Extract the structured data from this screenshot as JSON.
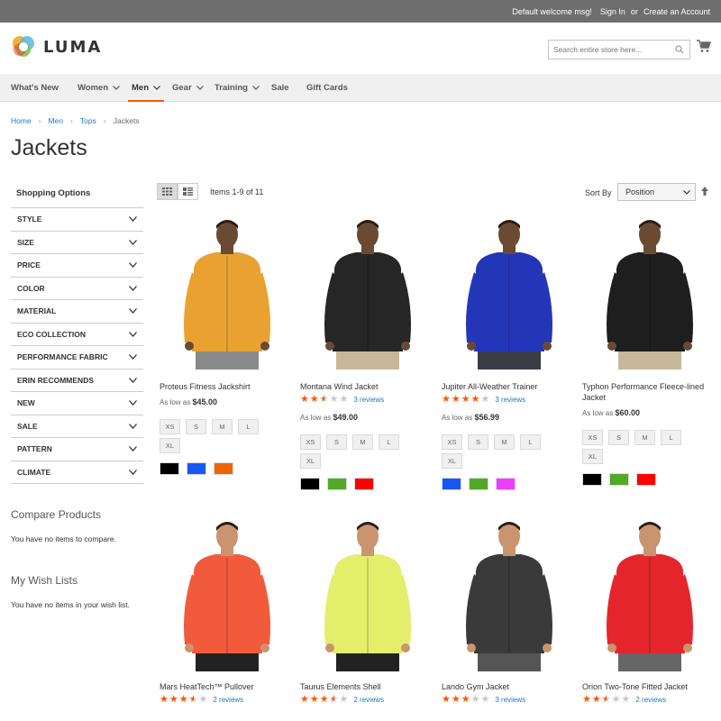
{
  "topbar": {
    "welcome": "Default welcome msg!",
    "sign_in": "Sign In",
    "or": "or",
    "create_account": "Create an Account"
  },
  "header": {
    "logo_text": "LUMA",
    "search_placeholder": "Search entire store here...",
    "icons": [
      "search-icon",
      "cart-icon"
    ]
  },
  "nav": {
    "items": [
      {
        "label": "What's New",
        "has_dropdown": false,
        "active": false
      },
      {
        "label": "Women",
        "has_dropdown": true,
        "active": false
      },
      {
        "label": "Men",
        "has_dropdown": true,
        "active": true
      },
      {
        "label": "Gear",
        "has_dropdown": true,
        "active": false
      },
      {
        "label": "Training",
        "has_dropdown": true,
        "active": false
      },
      {
        "label": "Sale",
        "has_dropdown": false,
        "active": false
      },
      {
        "label": "Gift Cards",
        "has_dropdown": false,
        "active": false
      }
    ]
  },
  "breadcrumb": {
    "items": [
      "Home",
      "Men",
      "Tops"
    ],
    "current": "Jackets"
  },
  "page_title": "Jackets",
  "sidebar": {
    "shopping_options": "Shopping Options",
    "filters": [
      "STYLE",
      "SIZE",
      "PRICE",
      "COLOR",
      "MATERIAL",
      "ECO COLLECTION",
      "PERFORMANCE FABRIC",
      "ERIN RECOMMENDS",
      "NEW",
      "SALE",
      "PATTERN",
      "CLIMATE"
    ],
    "compare_title": "Compare Products",
    "compare_text": "You have no items to compare.",
    "wishlist_title": "My Wish Lists",
    "wishlist_text": "You have no items in your wish list."
  },
  "toolbar": {
    "items_count": "Items 1-9 of 11",
    "sort_label": "Sort By",
    "sort_value": "Position"
  },
  "products": [
    {
      "name": "Proteus Fitness Jackshirt",
      "rating": 0,
      "reviews": "",
      "price_prefix": "As low as",
      "price": "$45.00",
      "sizes": [
        "XS",
        "S",
        "M",
        "L",
        "XL"
      ],
      "swatches": [
        "#000000",
        "#1857f7",
        "#eb6703"
      ],
      "jacket_color": "#e9a232",
      "pants_color": "#8a8a8a",
      "skin": "#6b4a34"
    },
    {
      "name": "Montana Wind Jacket",
      "rating": 2.5,
      "reviews": "3 reviews",
      "price_prefix": "As low as",
      "price": "$49.00",
      "sizes": [
        "XS",
        "S",
        "M",
        "L",
        "XL"
      ],
      "swatches": [
        "#000000",
        "#53a828",
        "#ff0000"
      ],
      "jacket_color": "#262626",
      "pants_color": "#c8b89a",
      "skin": "#6b4a34"
    },
    {
      "name": "Jupiter All-Weather Trainer",
      "rating": 4,
      "reviews": "3 reviews",
      "price_prefix": "As low as",
      "price": "$56.99",
      "sizes": [
        "XS",
        "S",
        "M",
        "L",
        "XL"
      ],
      "swatches": [
        "#1857f7",
        "#53a828",
        "#ef3dff"
      ],
      "jacket_color": "#2436b8",
      "pants_color": "#3c3c44",
      "skin": "#6b4a34"
    },
    {
      "name": "Typhon Performance Fleece-lined Jacket",
      "rating": 0,
      "reviews": "",
      "price_prefix": "As low as",
      "price": "$60.00",
      "sizes": [
        "XS",
        "S",
        "M",
        "L",
        "XL"
      ],
      "swatches": [
        "#000000",
        "#53a828",
        "#ff0000"
      ],
      "jacket_color": "#1e1e1e",
      "pants_color": "#c8b89a",
      "skin": "#6b4a34"
    },
    {
      "name": "Mars HeatTech™ Pullover",
      "rating": 3.5,
      "reviews": "2 reviews",
      "price_prefix": "",
      "price": "",
      "sizes": [],
      "swatches": [],
      "jacket_color": "#f25a3c",
      "pants_color": "#222222",
      "skin": "#c9946e"
    },
    {
      "name": "Taurus Elements Shell",
      "rating": 3.5,
      "reviews": "2 reviews",
      "price_prefix": "",
      "price": "",
      "sizes": [],
      "swatches": [],
      "jacket_color": "#e4ee6a",
      "pants_color": "#222222",
      "skin": "#c9946e"
    },
    {
      "name": "Lando Gym Jacket",
      "rating": 3,
      "reviews": "3 reviews",
      "price_prefix": "",
      "price": "",
      "sizes": [],
      "swatches": [],
      "jacket_color": "#3a3a3a",
      "pants_color": "#555555",
      "skin": "#c9946e"
    },
    {
      "name": "Orion Two-Tone Fitted Jacket",
      "rating": 2.5,
      "reviews": "2 reviews",
      "price_prefix": "",
      "price": "",
      "sizes": [],
      "swatches": [],
      "jacket_color": "#e4262c",
      "pants_color": "#666666",
      "skin": "#c9946e"
    }
  ],
  "colors": {
    "accent": "#ff5501",
    "link": "#1979c3",
    "star_filled": "#ff5501",
    "star_empty": "#c7c7c7"
  }
}
